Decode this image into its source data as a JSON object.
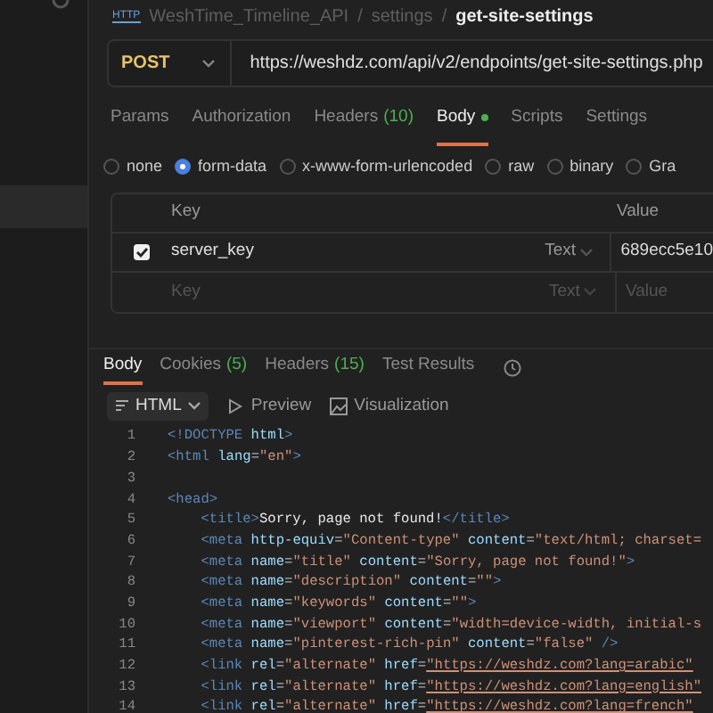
{
  "breadcrumb": {
    "badge": "HTTP",
    "parts": [
      "WeshTime_Timeline_API",
      "/",
      "settings",
      "/",
      "get-site-settings"
    ]
  },
  "request": {
    "method": "POST",
    "url": "https://weshdz.com/api/v2/endpoints/get-site-settings.php"
  },
  "request_tabs": [
    {
      "label": "Params",
      "selected": false
    },
    {
      "label": "Authorization",
      "selected": false
    },
    {
      "label": "Headers",
      "count": "(10)",
      "selected": false
    },
    {
      "label": "Body",
      "has_content": true,
      "selected": true
    },
    {
      "label": "Scripts",
      "selected": false
    },
    {
      "label": "Settings",
      "selected": false
    }
  ],
  "body_types": [
    {
      "label": "none",
      "selected": false
    },
    {
      "label": "form-data",
      "selected": true
    },
    {
      "label": "x-www-form-urlencoded",
      "selected": false
    },
    {
      "label": "raw",
      "selected": false
    },
    {
      "label": "binary",
      "selected": false
    },
    {
      "label": "Gra",
      "selected": false
    }
  ],
  "params_table": {
    "columns": [
      "Key",
      "Value"
    ],
    "rows": [
      {
        "checked": true,
        "key": "server_key",
        "type": "Text",
        "value": "689ecc5e10"
      }
    ],
    "new_row": {
      "key_placeholder": "Key",
      "type": "Text",
      "value_placeholder": "Value"
    }
  },
  "response_tabs": [
    {
      "label": "Body",
      "selected": true
    },
    {
      "label": "Cookies",
      "count": "(5)",
      "selected": false
    },
    {
      "label": "Headers",
      "count": "(15)",
      "selected": false
    },
    {
      "label": "Test Results",
      "selected": false
    }
  ],
  "view_modes": [
    {
      "label": "HTML",
      "kind": "dropdown"
    },
    {
      "label": "Preview",
      "kind": "preview"
    },
    {
      "label": "Visualization",
      "kind": "visualization"
    }
  ],
  "code_lines": [
    {
      "number": "1",
      "tokens": [
        {
          "kind": "tag",
          "text": "<!DOCTYPE"
        },
        {
          "kind": "attr",
          "text": " html"
        },
        {
          "kind": "tag",
          "text": ">"
        }
      ]
    },
    {
      "number": "2",
      "tokens": [
        {
          "kind": "tag",
          "text": "<html"
        },
        {
          "kind": "attr",
          "text": " lang"
        },
        {
          "kind": "punct",
          "text": "="
        },
        {
          "kind": "string",
          "text": "\"en\""
        },
        {
          "kind": "tag",
          "text": ">"
        }
      ]
    },
    {
      "number": "3"
    },
    {
      "number": "4",
      "tokens": [
        {
          "kind": "tag",
          "text": "<head>"
        }
      ]
    },
    {
      "number": "5",
      "tokens": [
        {
          "kind": "tag",
          "text": "    <title>"
        },
        {
          "kind": "text",
          "text": "Sorry, page not found!"
        },
        {
          "kind": "tag",
          "text": "</title>"
        }
      ]
    },
    {
      "number": "6",
      "tokens": [
        {
          "kind": "tag",
          "text": "    <meta"
        },
        {
          "kind": "attr",
          "text": " http-equiv"
        },
        {
          "kind": "punct",
          "text": "="
        },
        {
          "kind": "string",
          "text": "\"Content-type\""
        },
        {
          "kind": "attr",
          "text": " content"
        },
        {
          "kind": "punct",
          "text": "="
        },
        {
          "kind": "string",
          "text": "\"text/html; charset="
        }
      ]
    },
    {
      "number": "7",
      "tokens": [
        {
          "kind": "tag",
          "text": "    <meta"
        },
        {
          "kind": "attr",
          "text": " name"
        },
        {
          "kind": "punct",
          "text": "="
        },
        {
          "kind": "string",
          "text": "\"title\""
        },
        {
          "kind": "attr",
          "text": " content"
        },
        {
          "kind": "punct",
          "text": "="
        },
        {
          "kind": "string",
          "text": "\"Sorry, page not found!\""
        },
        {
          "kind": "tag",
          "text": ">"
        }
      ]
    },
    {
      "number": "8",
      "tokens": [
        {
          "kind": "tag",
          "text": "    <meta"
        },
        {
          "kind": "attr",
          "text": " name"
        },
        {
          "kind": "punct",
          "text": "="
        },
        {
          "kind": "string",
          "text": "\"description\""
        },
        {
          "kind": "attr",
          "text": " content"
        },
        {
          "kind": "punct",
          "text": "="
        },
        {
          "kind": "string",
          "text": "\"\""
        },
        {
          "kind": "tag",
          "text": ">"
        }
      ]
    },
    {
      "number": "9",
      "tokens": [
        {
          "kind": "tag",
          "text": "    <meta"
        },
        {
          "kind": "attr",
          "text": " name"
        },
        {
          "kind": "punct",
          "text": "="
        },
        {
          "kind": "string",
          "text": "\"keywords\""
        },
        {
          "kind": "attr",
          "text": " content"
        },
        {
          "kind": "punct",
          "text": "="
        },
        {
          "kind": "string",
          "text": "\"\""
        },
        {
          "kind": "tag",
          "text": ">"
        }
      ]
    },
    {
      "number": "10",
      "tokens": [
        {
          "kind": "tag",
          "text": "    <meta"
        },
        {
          "kind": "attr",
          "text": " name"
        },
        {
          "kind": "punct",
          "text": "="
        },
        {
          "kind": "string",
          "text": "\"viewport\""
        },
        {
          "kind": "attr",
          "text": " content"
        },
        {
          "kind": "punct",
          "text": "="
        },
        {
          "kind": "string",
          "text": "\"width=device-width, initial-s"
        }
      ]
    },
    {
      "number": "11",
      "tokens": [
        {
          "kind": "tag",
          "text": "    <meta"
        },
        {
          "kind": "attr",
          "text": " name"
        },
        {
          "kind": "punct",
          "text": "="
        },
        {
          "kind": "string",
          "text": "\"pinterest-rich-pin\""
        },
        {
          "kind": "attr",
          "text": " content"
        },
        {
          "kind": "punct",
          "text": "="
        },
        {
          "kind": "string",
          "text": "\"false\""
        },
        {
          "kind": "tag",
          "text": " />"
        }
      ]
    },
    {
      "number": "12",
      "tokens": [
        {
          "kind": "tag",
          "text": "    <link"
        },
        {
          "kind": "attr",
          "text": " rel"
        },
        {
          "kind": "punct",
          "text": "="
        },
        {
          "kind": "string",
          "text": "\"alternate\""
        },
        {
          "kind": "attr",
          "text": " href"
        },
        {
          "kind": "punct",
          "text": "="
        },
        {
          "kind": "link",
          "text": "\"https://weshdz.com?lang=arabic\""
        }
      ]
    },
    {
      "number": "13",
      "tokens": [
        {
          "kind": "tag",
          "text": "    <link"
        },
        {
          "kind": "attr",
          "text": " rel"
        },
        {
          "kind": "punct",
          "text": "="
        },
        {
          "kind": "string",
          "text": "\"alternate\""
        },
        {
          "kind": "attr",
          "text": " href"
        },
        {
          "kind": "punct",
          "text": "="
        },
        {
          "kind": "link",
          "text": "\"https://weshdz.com?lang=english\""
        }
      ]
    },
    {
      "number": "14",
      "tokens": [
        {
          "kind": "tag",
          "text": "    <link"
        },
        {
          "kind": "attr",
          "text": " rel"
        },
        {
          "kind": "punct",
          "text": "="
        },
        {
          "kind": "string",
          "text": "\"alternate\""
        },
        {
          "kind": "attr",
          "text": " href"
        },
        {
          "kind": "punct",
          "text": "="
        },
        {
          "kind": "link",
          "text": "\"https://weshdz.com?lang=french\""
        }
      ]
    }
  ]
}
